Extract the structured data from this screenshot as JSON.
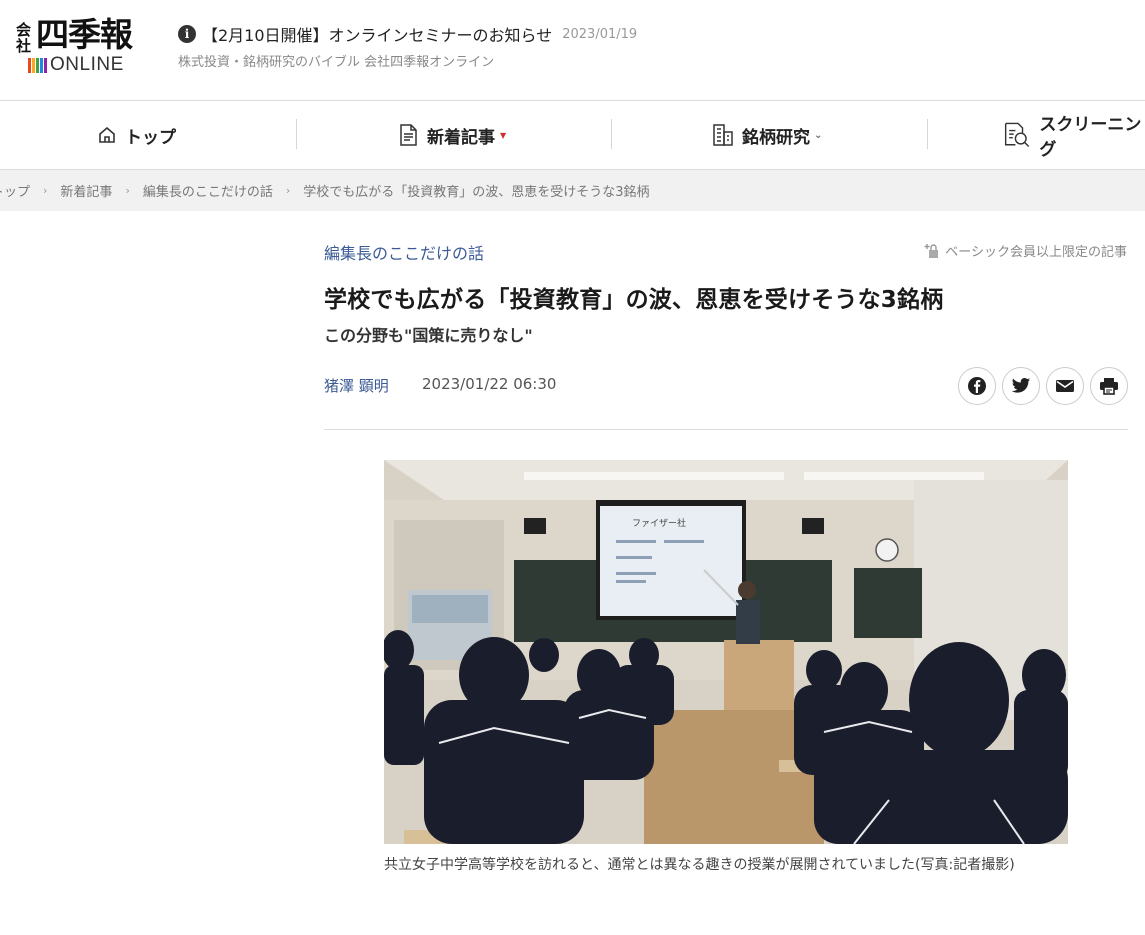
{
  "header": {
    "logo_kaisha": "会社",
    "logo_name": "四季報",
    "logo_online": "ONLINE",
    "logo_bar_colors": [
      "#e64a19",
      "#f9a825",
      "#43a047",
      "#1e88e5",
      "#8e24aa"
    ],
    "notice_icon": "info-icon",
    "notice_text": "【2月10日開催】オンラインセミナーのお知らせ",
    "notice_date": "2023/01/19",
    "tagline": "株式投資・銘柄研究のバイブル 会社四季報オンライン"
  },
  "nav": {
    "items": [
      {
        "label": "トップ",
        "icon": "home-icon"
      },
      {
        "label": "新着記事",
        "icon": "document-icon",
        "caret": "▼"
      },
      {
        "label": "銘柄研究",
        "icon": "building-icon",
        "caret": "⌄"
      },
      {
        "label": "スクリーニング",
        "icon": "screening-search-icon"
      }
    ]
  },
  "breadcrumb": {
    "items": [
      "トップ",
      "新着記事",
      "編集長のここだけの話",
      "学校でも広がる「投資教育」の波、恩恵を受けそうな3銘柄"
    ],
    "separator": "›"
  },
  "article": {
    "category": "編集長のここだけの話",
    "members_only": "ベーシック会員以上限定の記事",
    "title": "学校でも広がる「投資教育」の波、恩恵を受けそうな3銘柄",
    "subtitle": "この分野も\"国策に売りなし\"",
    "author": "猪澤 顕明",
    "date": "2023/01/22 06:30",
    "share_icons": [
      "facebook-icon",
      "twitter-icon",
      "mail-icon",
      "print-icon"
    ],
    "screen_text": "ファイザー社",
    "photo_caption": "共立女子中学高等学校を訪れると、通常とは異なる趣きの授業が展開されていました(写真:記者撮影)"
  },
  "colors": {
    "link_blue": "#3c5b96",
    "breadcrumb_bg": "#f1f1f1",
    "caret_red": "#d0312d"
  }
}
